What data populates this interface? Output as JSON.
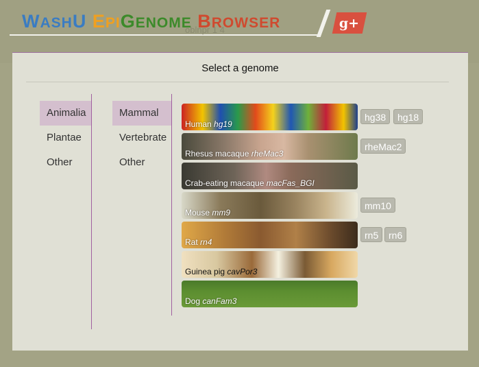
{
  "header": {
    "logo": {
      "words": [
        {
          "first": "W",
          "rest": "ASH",
          "color": "#3a7cc2"
        },
        {
          "first": "U",
          "rest": "",
          "color": "#3a7cc2"
        },
        {
          "first": "E",
          "rest": "PI",
          "color": "#f0a020"
        },
        {
          "first": "G",
          "rest": "ENOME",
          "color": "#3c8a2a"
        },
        {
          "first": "B",
          "rest": "ROWSER",
          "color": "#cf4a2f"
        }
      ]
    },
    "gplus_label": "g+",
    "ghost_text": "oblnpr 1 4"
  },
  "dialog": {
    "title": "Select a genome",
    "kingdoms": [
      "Animalia",
      "Plantae",
      "Other"
    ],
    "selected_kingdom": "Animalia",
    "groups": [
      "Mammal",
      "Vertebrate",
      "Other"
    ],
    "selected_group": "Mammal",
    "species": [
      {
        "name": "Human",
        "build": "hg19",
        "builds": [
          "hg38",
          "hg18"
        ]
      },
      {
        "name": "Rhesus macaque",
        "build": "rheMac3",
        "builds": [
          "rheMac2"
        ]
      },
      {
        "name": "Crab-eating macaque",
        "build": "macFas_BGI",
        "builds": []
      },
      {
        "name": "Mouse",
        "build": "mm9",
        "builds": [
          "mm10"
        ]
      },
      {
        "name": "Rat",
        "build": "rn4",
        "builds": [
          "rn5",
          "rn6"
        ]
      },
      {
        "name": "Guinea pig",
        "build": "cavPor3",
        "builds": []
      },
      {
        "name": "Dog",
        "build": "canFam3",
        "builds": []
      }
    ]
  }
}
